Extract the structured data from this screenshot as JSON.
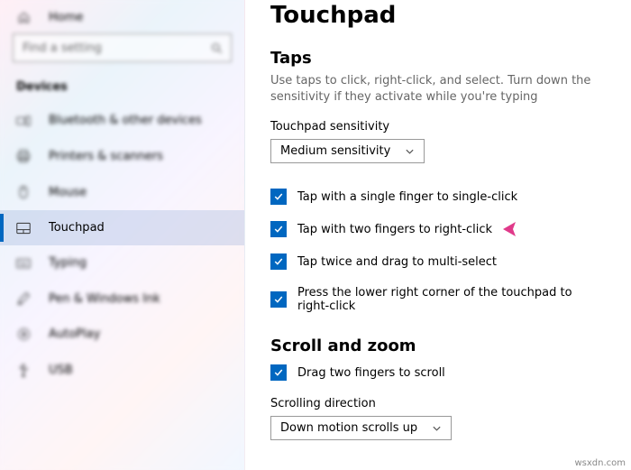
{
  "home_label": "Home",
  "search": {
    "placeholder": "Find a setting"
  },
  "section": "Devices",
  "nav": [
    {
      "label": "Bluetooth & other devices"
    },
    {
      "label": "Printers & scanners"
    },
    {
      "label": "Mouse"
    },
    {
      "label": "Touchpad"
    },
    {
      "label": "Typing"
    },
    {
      "label": "Pen & Windows Ink"
    },
    {
      "label": "AutoPlay"
    },
    {
      "label": "USB"
    }
  ],
  "page": {
    "title": "Touchpad",
    "taps": {
      "heading": "Taps",
      "description": "Use taps to click, right-click, and select. Turn down the sensitivity if they activate while you're typing",
      "sensitivity_label": "Touchpad sensitivity",
      "sensitivity_value": "Medium sensitivity",
      "checks": [
        "Tap with a single finger to single-click",
        "Tap with two fingers to right-click",
        "Tap twice and drag to multi-select",
        "Press the lower right corner of the touchpad to right-click"
      ]
    },
    "scroll": {
      "heading": "Scroll and zoom",
      "drag_label": "Drag two fingers to scroll",
      "direction_label": "Scrolling direction",
      "direction_value": "Down motion scrolls up"
    }
  },
  "watermark": "wsxdn.com"
}
